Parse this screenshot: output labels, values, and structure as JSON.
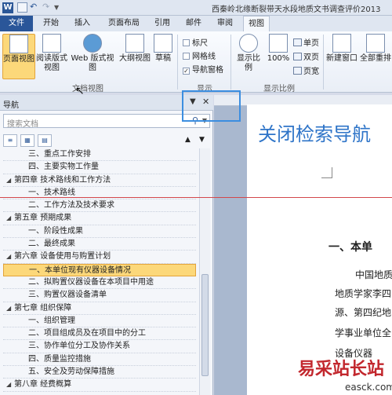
{
  "titlebar": {
    "title": "西秦岭北缘断裂带天水段地质文书调查评价2013"
  },
  "tabs": [
    "文件",
    "开始",
    "插入",
    "页面布局",
    "引用",
    "邮件",
    "审阅",
    "视图"
  ],
  "ribbon": {
    "doc_views": [
      "页面视图",
      "阅读版式视图",
      "Web 版式视图",
      "大纲视图",
      "草稿"
    ],
    "doc_views_group": "文档视图",
    "show": {
      "ruler": "标尺",
      "gridlines": "网格线",
      "nav_pane": "导航窗格",
      "group": "显示"
    },
    "zoom": {
      "zoom_btn": "显示比例",
      "percent": "100%",
      "single": "单页",
      "double": "双页",
      "width": "页宽",
      "group": "显示比例"
    },
    "window": {
      "new_window": "新建窗口",
      "arrange_all": "全部重排"
    }
  },
  "nav": {
    "title": "导航",
    "dropdown": "▼",
    "close": "✕",
    "search_placeholder": "搜索文档",
    "items": [
      {
        "text": "三、重点工作安排",
        "level": 2
      },
      {
        "text": "四、主要实物工作量",
        "level": 2
      },
      {
        "text": "第四章 技术路线和工作方法",
        "level": 1
      },
      {
        "text": "一、技术路线",
        "level": 2
      },
      {
        "text": "二、工作方法及技术要求",
        "level": 2
      },
      {
        "text": "第五章 预期成果",
        "level": 1
      },
      {
        "text": "一、阶段性成果",
        "level": 2
      },
      {
        "text": "二、最终成果",
        "level": 2
      },
      {
        "text": "第六章 设备使用与购置计划",
        "level": 1
      },
      {
        "text": "一、本单位现有仪器设备情况",
        "level": 2,
        "selected": true
      },
      {
        "text": "二、拟购置仪器设备在本项目中用途",
        "level": 2
      },
      {
        "text": "三、购置仪器设备清单",
        "level": 2
      },
      {
        "text": "第七章 组织保障",
        "level": 1
      },
      {
        "text": "一、组织管理",
        "level": 2
      },
      {
        "text": "二、项目组成员及在项目中的分工",
        "level": 2
      },
      {
        "text": "三、协作单位分工及协作关系",
        "level": 2
      },
      {
        "text": "四、质量监控措施",
        "level": 2
      },
      {
        "text": "五、安全及劳动保障措施",
        "level": 2
      },
      {
        "text": "第八章 经费概算",
        "level": 1
      }
    ]
  },
  "document": {
    "heading": "关闭检索导航",
    "h2": "一、本单",
    "lines": [
      "中国地质",
      "地质学家李四",
      "源、第四纪地",
      "学事业单位全",
      "设备仪器"
    ]
  },
  "watermark": {
    "main": "易采站长站",
    "url": "easck.com"
  }
}
